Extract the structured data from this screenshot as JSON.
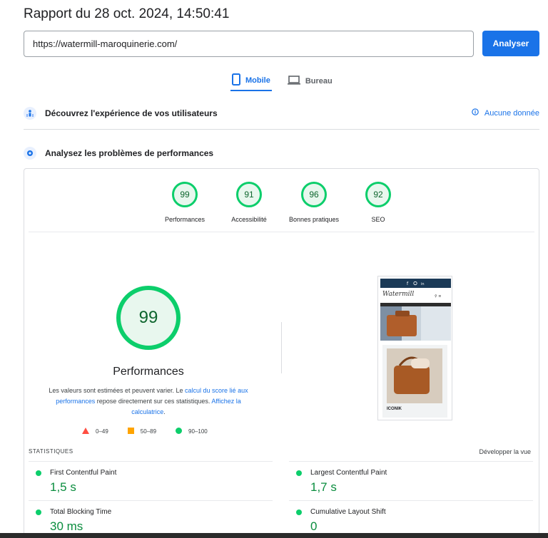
{
  "header": {
    "title": "Rapport du 28 oct. 2024, 14:50:41"
  },
  "search": {
    "url": "https://watermill-maroquinerie.com/",
    "button": "Analyser"
  },
  "tabs": [
    {
      "label": "Mobile",
      "active": true
    },
    {
      "label": "Bureau",
      "active": false
    }
  ],
  "field_section": {
    "title": "Découvrez l'expérience de vos utilisateurs",
    "status": "Aucune donnée"
  },
  "lab_section": {
    "title": "Analysez les problèmes de performances"
  },
  "scores": [
    {
      "label": "Performances",
      "value": "99"
    },
    {
      "label": "Accessibilité",
      "value": "91"
    },
    {
      "label": "Bonnes pratiques",
      "value": "96"
    },
    {
      "label": "SEO",
      "value": "92"
    }
  ],
  "main_score": {
    "value": "99",
    "title": "Performances",
    "note_1": "Les valeurs sont estimées et peuvent varier. Le ",
    "note_link_1": "calcul du score lié aux performances",
    "note_2": " repose directement sur ces statistiques. ",
    "note_link_2": "Affichez la calculatrice",
    "note_3": "."
  },
  "legend": [
    {
      "range": "0–49",
      "color": "#ff4e42"
    },
    {
      "range": "50–89",
      "color": "#ffa400"
    },
    {
      "range": "90–100",
      "color": "#0cce6b"
    }
  ],
  "screenshot": {
    "brand": "Watermill",
    "product": "ICONIK"
  },
  "stats": {
    "label": "STATISTIQUES",
    "expand": "Développer la vue",
    "metrics": [
      {
        "name": "First Contentful Paint",
        "value": "1,5 s"
      },
      {
        "name": "Largest Contentful Paint",
        "value": "1,7 s"
      },
      {
        "name": "Total Blocking Time",
        "value": "30 ms"
      },
      {
        "name": "Cumulative Layout Shift",
        "value": "0"
      }
    ]
  },
  "colors": {
    "accent": "#1a73e8",
    "pass": "#0cce6b",
    "pass_text": "#0a8d3e"
  }
}
